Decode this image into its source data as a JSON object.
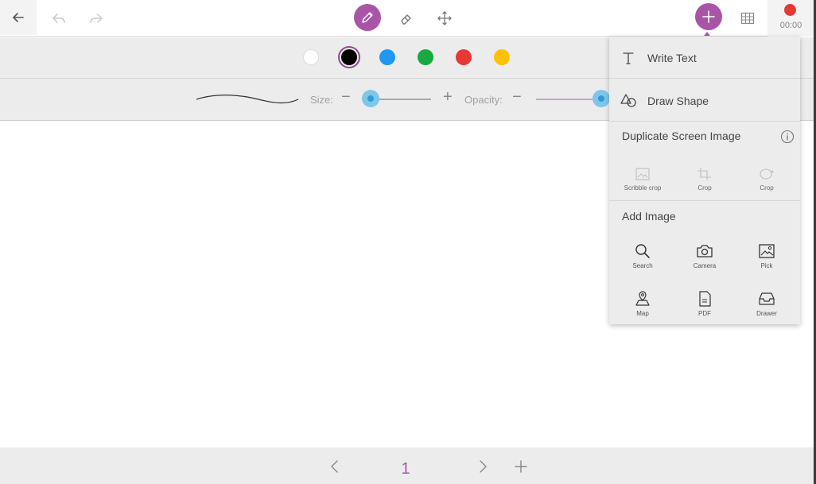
{
  "toolbar": {
    "icons": [
      "back-arrow-icon",
      "undo-icon",
      "redo-icon",
      "pencil-icon",
      "eraser-icon",
      "move-icon",
      "plus-icon",
      "grid-icon"
    ],
    "record_time": "00:00"
  },
  "colors": {
    "swatches": [
      "#ffffff",
      "#000000",
      "#2196f3",
      "#1aa843",
      "#e53935",
      "#ffc107"
    ],
    "selected": "#000000",
    "accent": "#a855a8",
    "slider": "#7ec7ea"
  },
  "brush": {
    "size_label": "Size:",
    "opacity_label": "Opacity:",
    "size_value": 0,
    "opacity_value": 1
  },
  "menu": {
    "write_text": "Write Text",
    "draw_shape": "Draw Shape",
    "duplicate_title": "Duplicate Screen Image",
    "duplicate_items": [
      "Scribble crop",
      "Crop",
      "Crop"
    ],
    "add_image_title": "Add Image",
    "image_items": [
      "Search",
      "Camera",
      "Pick",
      "Map",
      "PDF",
      "Drawer"
    ]
  },
  "pager": {
    "current_page": "1"
  }
}
